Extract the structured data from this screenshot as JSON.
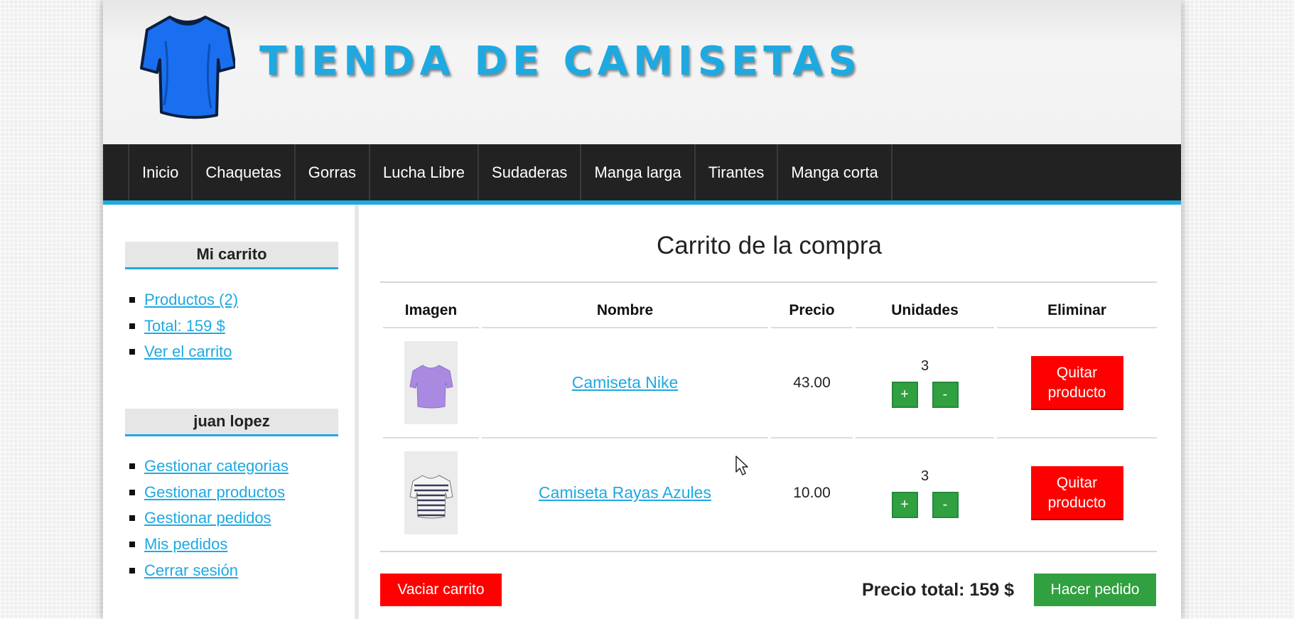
{
  "header": {
    "title": "TIENDA DE CAMISETAS",
    "logo_icon": "tshirt-icon",
    "logo_color": "#1a6ff0",
    "accent": "#1ea9e1"
  },
  "nav": {
    "items": [
      {
        "label": "Inicio"
      },
      {
        "label": "Chaquetas"
      },
      {
        "label": "Gorras"
      },
      {
        "label": "Lucha Libre"
      },
      {
        "label": "Sudaderas"
      },
      {
        "label": "Manga larga"
      },
      {
        "label": "Tirantes"
      },
      {
        "label": "Manga corta"
      }
    ]
  },
  "sidebar": {
    "cart_block": {
      "title": "Mi carrito",
      "links": [
        {
          "label": "Productos (2)"
        },
        {
          "label": "Total: 159 $"
        },
        {
          "label": "Ver el carrito"
        }
      ]
    },
    "user_block": {
      "title": "juan lopez",
      "links": [
        {
          "label": "Gestionar categorias"
        },
        {
          "label": "Gestionar productos"
        },
        {
          "label": "Gestionar pedidos"
        },
        {
          "label": "Mis pedidos"
        },
        {
          "label": "Cerrar sesión"
        }
      ]
    }
  },
  "cart": {
    "title": "Carrito de la compra",
    "columns": [
      "Imagen",
      "Nombre",
      "Precio",
      "Unidades",
      "Eliminar"
    ],
    "rows": [
      {
        "name": "Camiseta Nike",
        "price": "43.00",
        "units": "3",
        "plus": "+",
        "minus": "-",
        "remove": "Quitar producto",
        "image": "purple-tshirt"
      },
      {
        "name": "Camiseta Rayas Azules",
        "price": "10.00",
        "units": "3",
        "plus": "+",
        "minus": "-",
        "remove": "Quitar producto",
        "image": "striped-tshirt"
      }
    ],
    "empty_label": "Vaciar carrito",
    "total_label": "Precio total: 159 $",
    "order_label": "Hacer pedido",
    "colors": {
      "danger": "#ff0000",
      "success": "#30a040"
    }
  }
}
